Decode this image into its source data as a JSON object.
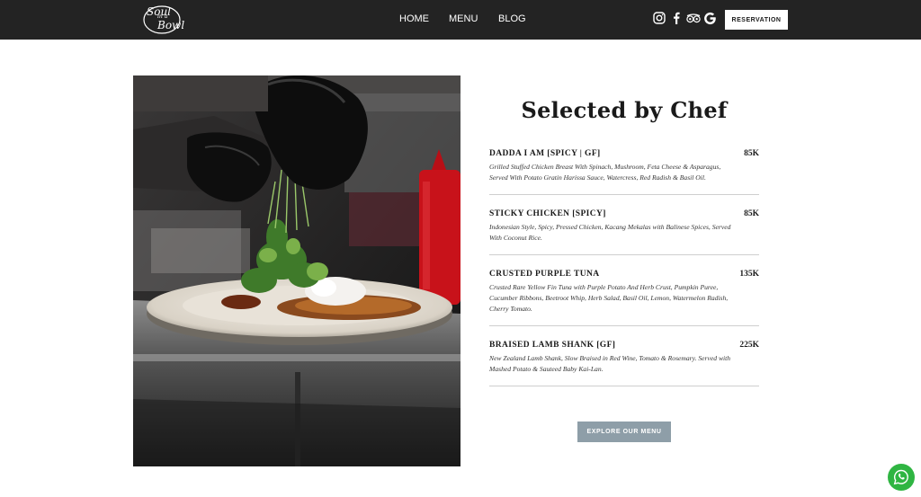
{
  "header": {
    "logo": {
      "line1": "Soul",
      "line2": "in a",
      "line3": "Bowl"
    },
    "nav": [
      {
        "label": "HOME"
      },
      {
        "label": "MENU"
      },
      {
        "label": "BLOG"
      }
    ],
    "social_icons": [
      "instagram-icon",
      "facebook-icon",
      "tripadvisor-icon",
      "google-icon"
    ],
    "reservation_label": "RESERVATION",
    "background_color": "#232323"
  },
  "photo": {
    "subject": "chef-plating-dish-photo"
  },
  "menu": {
    "title": "Selected by Chef",
    "items": [
      {
        "name": "DADDA I AM [SPICY | GF]",
        "price": "85K",
        "description": "Grilled Stuffed Chicken Breast With Spinach, Mushroom, Feta Cheese & Asparagus, Served With Potato Gratin Harissa Sauce, Watercress, Red Radish & Basil Oil."
      },
      {
        "name": "STICKY CHICKEN [SPICY]",
        "price": "85K",
        "description": "Indonesian Style, Spicy, Pressed Chicken, Kacang Mekalas with Balinese Spices, Served With Coconut Rice."
      },
      {
        "name": "CRUSTED PURPLE TUNA",
        "price": "135K",
        "description": "Crusted Rare Yellow Fin Tuna with Purple Potato And Herb Crust, Pumpkin Puree, Cucumber Ribbons, Beetroot Whip, Herb Salad, Basil Oil, Lemon, Watermelon Radish, Cherry Tomato."
      },
      {
        "name": "BRAISED LAMB SHANK [GF]",
        "price": "225K",
        "description": "New Zealand Lamb Shank, Slow Braised in Red Wine, Tomato & Rosemary. Served with Mashed Potato & Sauteed Baby Kai-Lan."
      }
    ],
    "explore_label": "EXPLORE OUR MENU",
    "explore_color": "#8e9ea8"
  },
  "floating": {
    "whatsapp_icon": "whatsapp-icon",
    "color": "#2fb542"
  }
}
